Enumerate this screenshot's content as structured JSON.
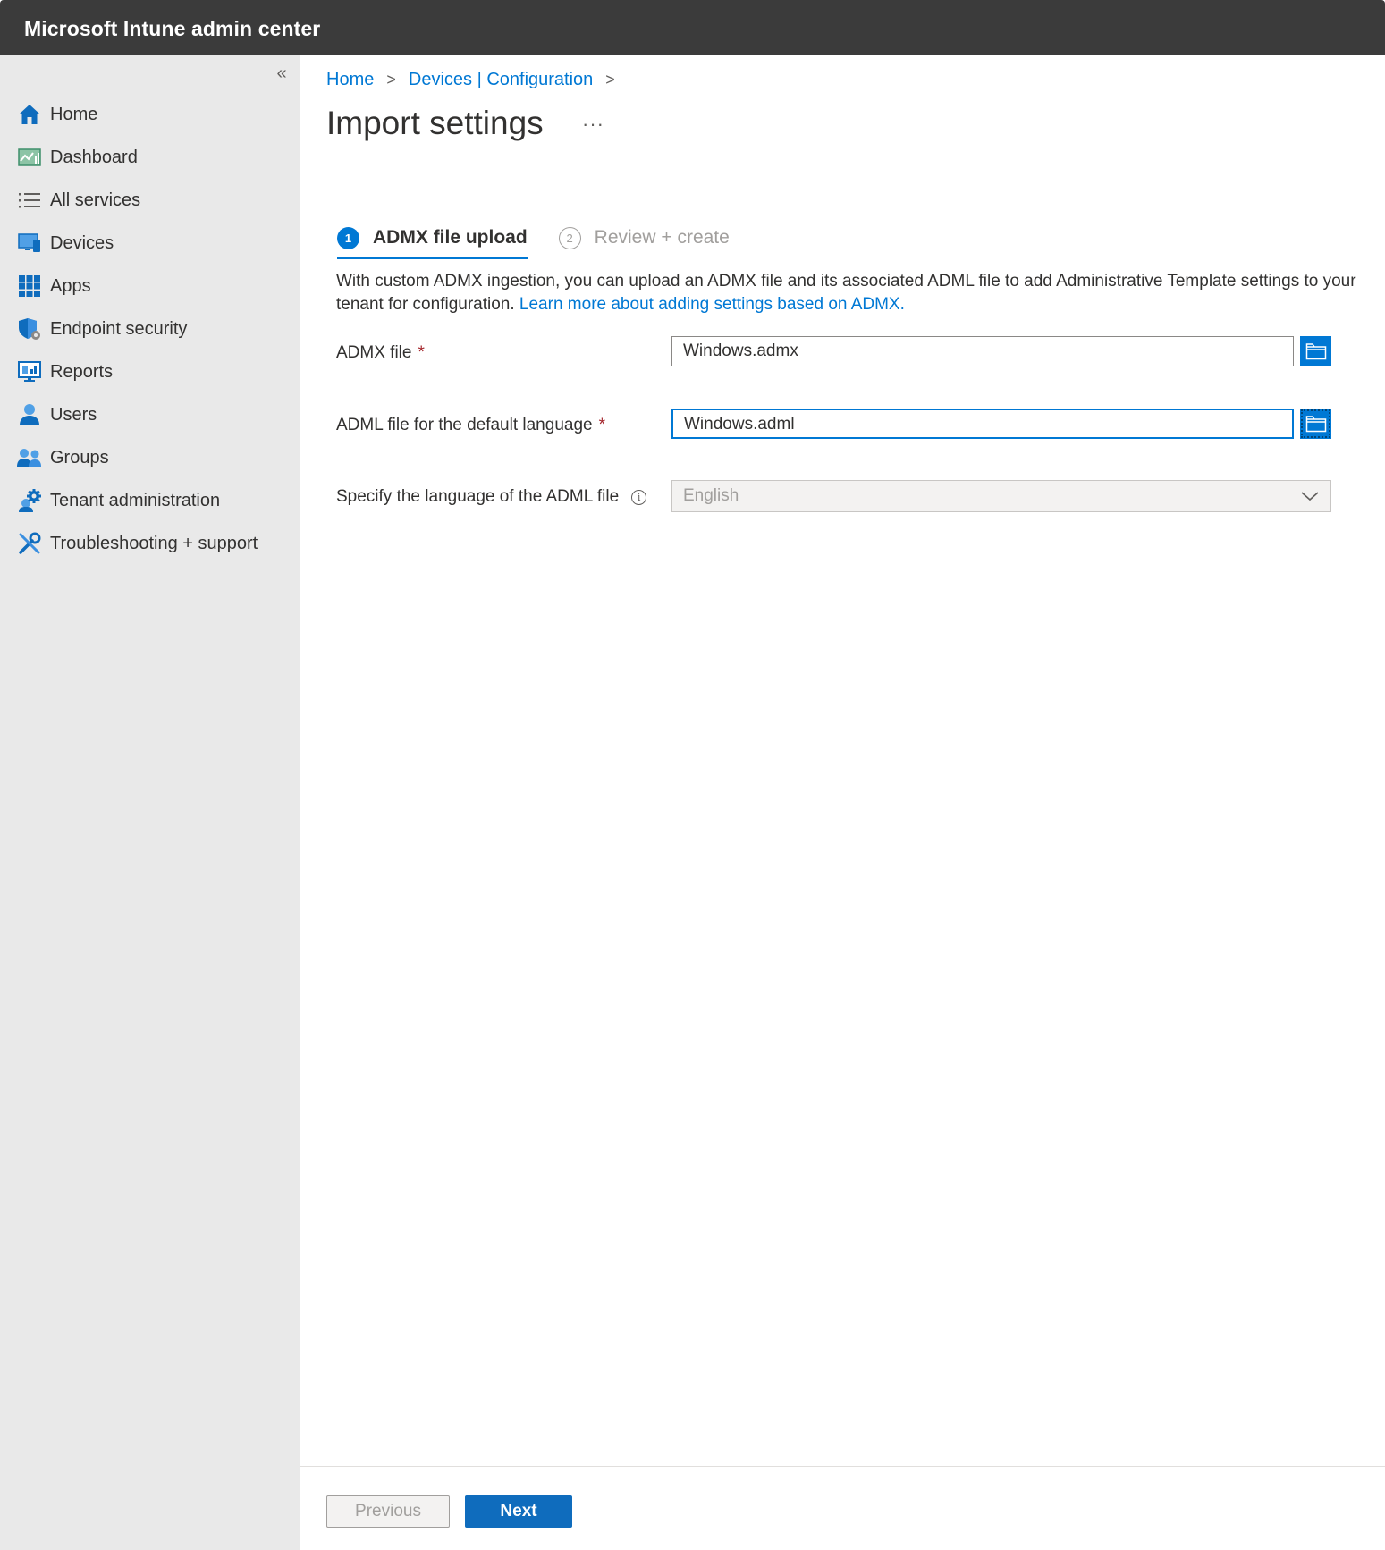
{
  "app": {
    "title": "Microsoft Intune admin center"
  },
  "sidebar": {
    "collapse_glyph": "«",
    "items": [
      {
        "label": "Home",
        "icon": "home-icon"
      },
      {
        "label": "Dashboard",
        "icon": "dashboard-icon"
      },
      {
        "label": "All services",
        "icon": "list-icon"
      },
      {
        "label": "Devices",
        "icon": "devices-icon"
      },
      {
        "label": "Apps",
        "icon": "apps-grid-icon"
      },
      {
        "label": "Endpoint security",
        "icon": "shield-icon"
      },
      {
        "label": "Reports",
        "icon": "reports-icon"
      },
      {
        "label": "Users",
        "icon": "user-icon"
      },
      {
        "label": "Groups",
        "icon": "groups-icon"
      },
      {
        "label": "Tenant administration",
        "icon": "gear-icon"
      },
      {
        "label": "Troubleshooting + support",
        "icon": "tools-icon"
      }
    ]
  },
  "breadcrumb": {
    "home": "Home",
    "devices": "Devices | Configuration",
    "sep": ">"
  },
  "page": {
    "title": "Import settings",
    "more": "···"
  },
  "wizard": {
    "tabs": [
      {
        "num": "1",
        "label": "ADMX file upload",
        "active": true
      },
      {
        "num": "2",
        "label": "Review + create",
        "active": false
      }
    ]
  },
  "description": {
    "text": "With custom ADMX ingestion, you can upload an ADMX file and its associated ADML file to add Administrative Template settings to your tenant for configuration. ",
    "link": "Learn more about adding settings based on ADMX."
  },
  "form": {
    "admx": {
      "label": "ADMX file",
      "required": "*",
      "value": "Windows.admx"
    },
    "adml": {
      "label": "ADML file for the default language",
      "required": "*",
      "value": "Windows.adml"
    },
    "language": {
      "label": "Specify the language of the ADML file",
      "info": "i",
      "value": "English"
    }
  },
  "footer": {
    "previous": "Previous",
    "next": "Next"
  },
  "colors": {
    "accent": "#0078d4",
    "topbar": "#3b3b3b",
    "sidebar": "#e9e9e9",
    "required": "#a4262c"
  }
}
